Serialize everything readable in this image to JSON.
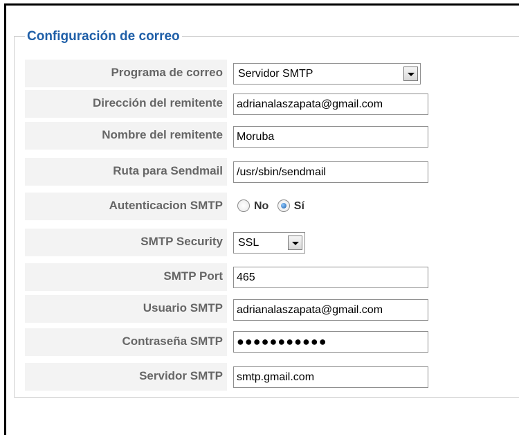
{
  "section": {
    "legend": "Configuración de correo"
  },
  "fields": {
    "mailer": {
      "label": "Programa de correo",
      "value": "Servidor SMTP"
    },
    "mail_from": {
      "label": "Dirección del remitente",
      "value": "adrianalaszapata@gmail.com"
    },
    "from_name": {
      "label": "Nombre del remitente",
      "value": "Moruba"
    },
    "sendmail_path": {
      "label": "Ruta para Sendmail",
      "value": "/usr/sbin/sendmail"
    },
    "smtp_auth": {
      "label": "Autenticacion SMTP",
      "options": [
        "No",
        "Sí"
      ],
      "selected": "Sí"
    },
    "smtp_security": {
      "label": "SMTP Security",
      "value": "SSL"
    },
    "smtp_port": {
      "label": "SMTP Port",
      "value": "465"
    },
    "smtp_user": {
      "label": "Usuario SMTP",
      "value": "adrianalaszapata@gmail.com"
    },
    "smtp_pass": {
      "label": "Contraseña SMTP",
      "value": "●●●●●●●●●●●"
    },
    "smtp_host": {
      "label": "Servidor SMTP",
      "value": "smtp.gmail.com"
    }
  },
  "colors": {
    "legend": "#1f5fa8",
    "label_bg": "#f3f3f3",
    "label_text": "#666666"
  }
}
